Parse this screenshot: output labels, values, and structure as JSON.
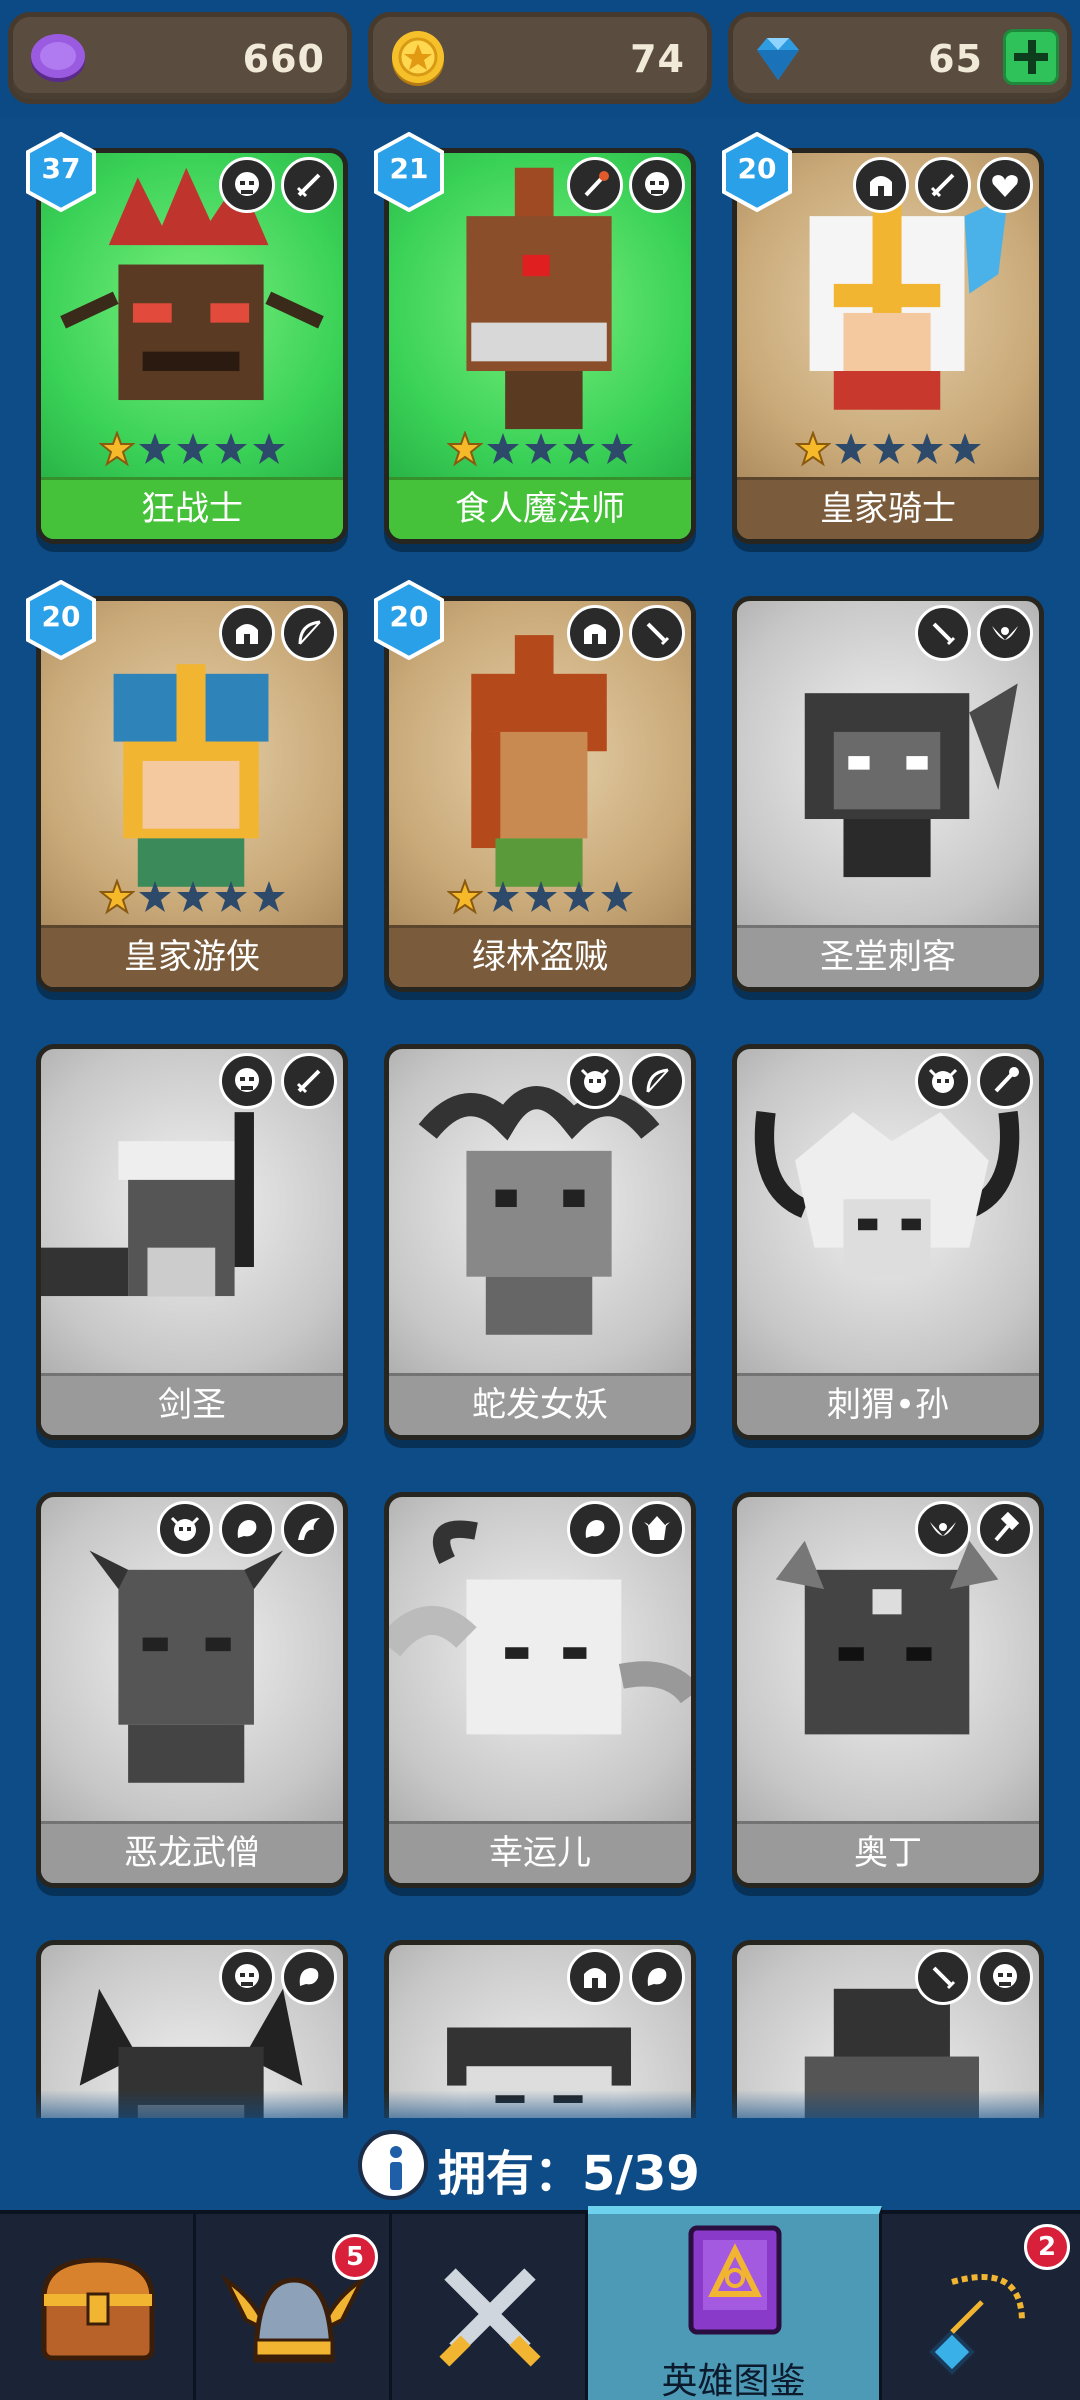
{
  "currency": {
    "tokens": "660",
    "coins": "74",
    "gems": "65",
    "icons": [
      "purple-token-icon",
      "gold-coin-icon",
      "blue-gem-icon",
      "plus-icon"
    ]
  },
  "heroes": [
    {
      "name": "狂战士",
      "level": "37",
      "stars": 1,
      "owned": true,
      "theme": "green",
      "badges": [
        "orc-class-icon",
        "sword-icon"
      ]
    },
    {
      "name": "食人魔法师",
      "level": "21",
      "stars": 1,
      "owned": true,
      "theme": "green",
      "badges": [
        "staff-icon",
        "orc-class-icon"
      ]
    },
    {
      "name": "皇家骑士",
      "level": "20",
      "stars": 1,
      "owned": true,
      "theme": "tan",
      "badges": [
        "helmet-icon",
        "sword-icon",
        "heart-icon"
      ]
    },
    {
      "name": "皇家游侠",
      "level": "20",
      "stars": 1,
      "owned": true,
      "theme": "tan",
      "badges": [
        "helmet-icon",
        "bow-icon"
      ]
    },
    {
      "name": "绿林盗贼",
      "level": "20",
      "stars": 1,
      "owned": true,
      "theme": "tan",
      "badges": [
        "helmet-icon",
        "dagger-icon"
      ]
    },
    {
      "name": "圣堂刺客",
      "owned": false,
      "badges": [
        "dagger-icon",
        "wings-icon"
      ]
    },
    {
      "name": "剑圣",
      "owned": false,
      "badges": [
        "orc-class-icon",
        "sword-icon"
      ]
    },
    {
      "name": "蛇发女妖",
      "owned": false,
      "badges": [
        "demon-skull-icon",
        "bow-icon"
      ]
    },
    {
      "name": "刺猬•孙",
      "owned": false,
      "badges": [
        "demon-skull-icon",
        "staff-icon"
      ]
    },
    {
      "name": "恶龙武僧",
      "owned": false,
      "badges": [
        "demon-skull-icon",
        "beast-icon",
        "dragon-icon"
      ]
    },
    {
      "name": "幸运儿",
      "owned": false,
      "badges": [
        "beast-icon",
        "elf-icon"
      ]
    },
    {
      "name": "奥丁",
      "owned": false,
      "badges": [
        "wings-icon",
        "hammer-icon"
      ]
    },
    {
      "name": "",
      "owned": false,
      "badges": [
        "orc-class-icon",
        "beast-icon"
      ]
    },
    {
      "name": "",
      "owned": false,
      "badges": [
        "helmet-icon",
        "beast-icon"
      ]
    },
    {
      "name": "",
      "owned": false,
      "badges": [
        "dagger-icon",
        "orc-class-icon"
      ]
    }
  ],
  "ownership": {
    "label": "拥有：",
    "count": "5/39"
  },
  "nav": {
    "tabs": [
      {
        "id": "chest",
        "icon": "treasure-chest-icon",
        "label": "",
        "badge": ""
      },
      {
        "id": "heroes",
        "icon": "winged-helmet-icon",
        "label": "",
        "badge": "5"
      },
      {
        "id": "battle",
        "icon": "crossed-swords-icon",
        "label": "",
        "badge": ""
      },
      {
        "id": "codex",
        "icon": "spellbook-icon",
        "label": "英雄图鉴",
        "badge": "",
        "active": true
      },
      {
        "id": "amulet",
        "icon": "amulet-icon",
        "label": "",
        "badge": "2"
      }
    ]
  },
  "colors": {
    "background": "#0d4c86",
    "owned_green": "#46c23a",
    "owned_tan": "#7a5c3c",
    "locked": "#9a9a9a",
    "level_badge": "#2aa0e8",
    "active_tab": "#4d9ab6"
  }
}
